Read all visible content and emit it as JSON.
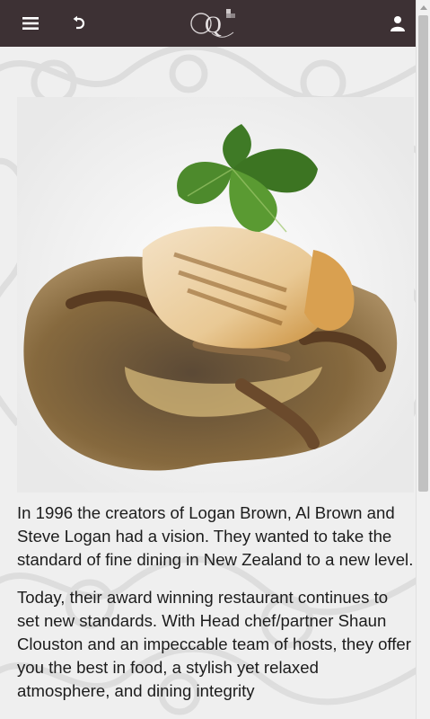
{
  "toolbar": {
    "menu_icon": "hamburger-menu-icon",
    "back_icon": "undo-back-icon",
    "logo_text": "Q",
    "user_icon": "user-profile-icon"
  },
  "hero": {
    "alt": "Plated fish fillet with mushrooms and watercress"
  },
  "article": {
    "paragraph1": "In 1996 the creators of Logan Brown, Al Brown and Steve Logan had a vision. They wanted to take the standard of fine dining in New Zealand to a new level.",
    "paragraph2": "Today, their award winning restaurant continues to set new standards. With Head chef/partner Shaun Clouston and an impeccable team of hosts, they offer you the best in food, a stylish yet relaxed atmosphere, and dining integrity"
  },
  "colors": {
    "topbar": "#3d3134",
    "text": "#1c1c1c"
  }
}
